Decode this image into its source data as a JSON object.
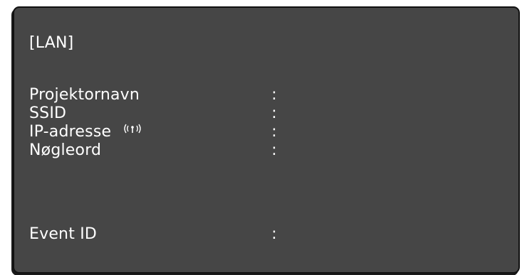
{
  "window": {
    "title": "[LAN]"
  },
  "rows": [
    {
      "label": "Projektornavn",
      "separator": ":",
      "value": ""
    },
    {
      "label": "SSID",
      "separator": ":",
      "value": ""
    },
    {
      "label": "IP-adresse",
      "separator": ":",
      "value": "",
      "icon": "wireless-signal-icon"
    },
    {
      "label": "Nøgleord",
      "separator": ":",
      "value": ""
    },
    {
      "label": "Event ID",
      "separator": ":",
      "value": ""
    }
  ],
  "colors": {
    "panel_background": "#464646",
    "text": "#ffffff",
    "border": "#111111"
  }
}
